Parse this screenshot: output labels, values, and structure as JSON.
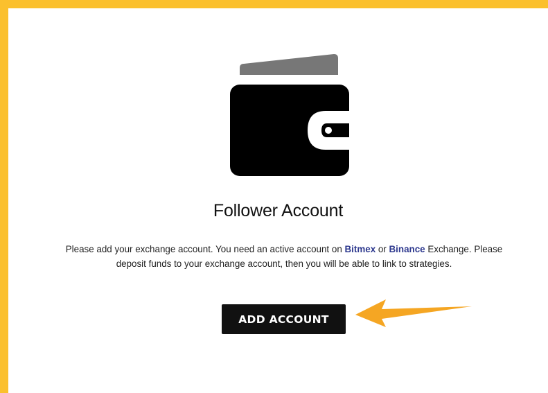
{
  "card": {
    "title": "Follower Account",
    "description": {
      "part1": "Please add your exchange account. You need an active account on ",
      "link_bitmex": "Bitmex",
      "part2": " or ",
      "link_binance": "Binance",
      "part3": " Exchange. Please deposit funds to your exchange account, then you will be able to link to strategies."
    },
    "add_button_label": "ADD ACCOUNT"
  },
  "icons": {
    "wallet": "wallet-icon",
    "arrow": "arrow-left-icon"
  },
  "colors": {
    "frame": "#fbc02d",
    "link": "#2f3a8f",
    "arrow": "#f5a623",
    "button": "#111111"
  }
}
